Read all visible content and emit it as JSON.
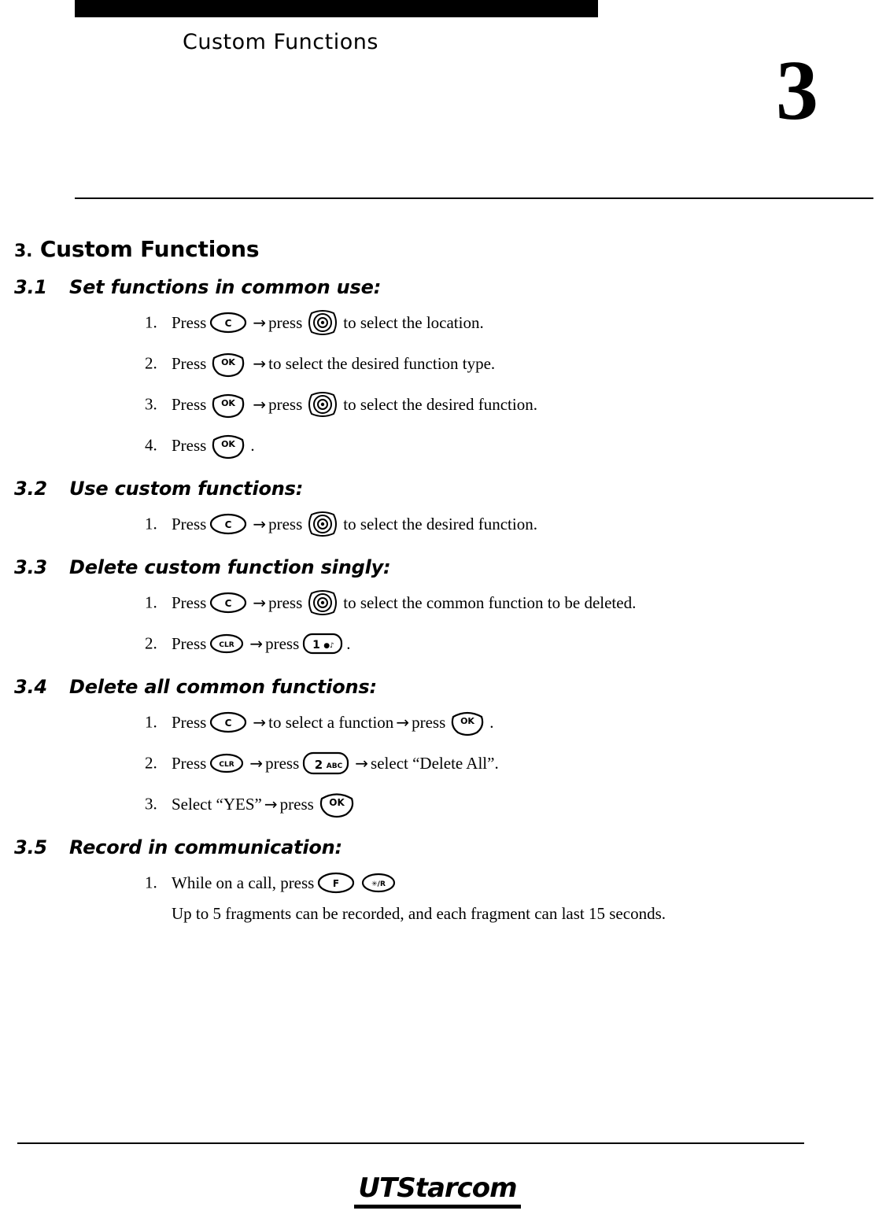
{
  "header": {
    "running_title": "Custom Functions",
    "chapter_number": "3"
  },
  "headings": {
    "h1_num": "3.",
    "h1_text": "Custom Functions",
    "s1_num": "3.1",
    "s1_text": "Set functions in common use:",
    "s2_num": "3.2",
    "s2_text": "Use custom functions:",
    "s3_num": "3.3",
    "s3_text": "Delete custom function singly:",
    "s4_num": "3.4",
    "s4_text": "Delete all common functions:",
    "s5_num": "3.5",
    "s5_text": "Record in communication:"
  },
  "markers": {
    "m1": "1.",
    "m2": "2.",
    "m3": "3.",
    "m4": "4."
  },
  "arrow": "→",
  "sec31": {
    "step1_a": "Press",
    "step1_b": "press",
    "step1_c": "to select the location.",
    "step2_a": "Press",
    "step2_b": "to select the desired function type.",
    "step3_a": "Press",
    "step3_b": "press",
    "step3_c": "to select the desired function.",
    "step4_a": "Press",
    "step4_b": "."
  },
  "sec32": {
    "step1_a": "Press",
    "step1_b": "press",
    "step1_c": "to select the desired function."
  },
  "sec33": {
    "step1_a": "Press",
    "step1_b": "press",
    "step1_c": "to select the common function to be deleted.",
    "step2_a": "Press",
    "step2_b": "press",
    "step2_c": "."
  },
  "sec34": {
    "step1_a": "Press",
    "step1_b": "to select a function",
    "step1_c": "press",
    "step1_d": ".",
    "step2_a": "Press",
    "step2_b": "press",
    "step2_c": "select “Delete All”.",
    "step3_a": "Select “YES”",
    "step3_b": "press"
  },
  "sec35": {
    "step1_a": "While on a call, press",
    "note": "Up to 5 fragments can be recorded, and each fragment can last 15 seconds."
  },
  "keys": {
    "c": "C",
    "ok": "OK",
    "clr": "CLR",
    "one": "1",
    "one_sub": "●♪",
    "two": "2",
    "two_sub": "ABC",
    "f": "F",
    "fr": "✱/R",
    "nav": "navigation-pad"
  },
  "footer": {
    "logo_ut": "UT",
    "logo_starcom": "Starcom"
  },
  "colors": {
    "ink": "#000000",
    "page": "#ffffff"
  }
}
